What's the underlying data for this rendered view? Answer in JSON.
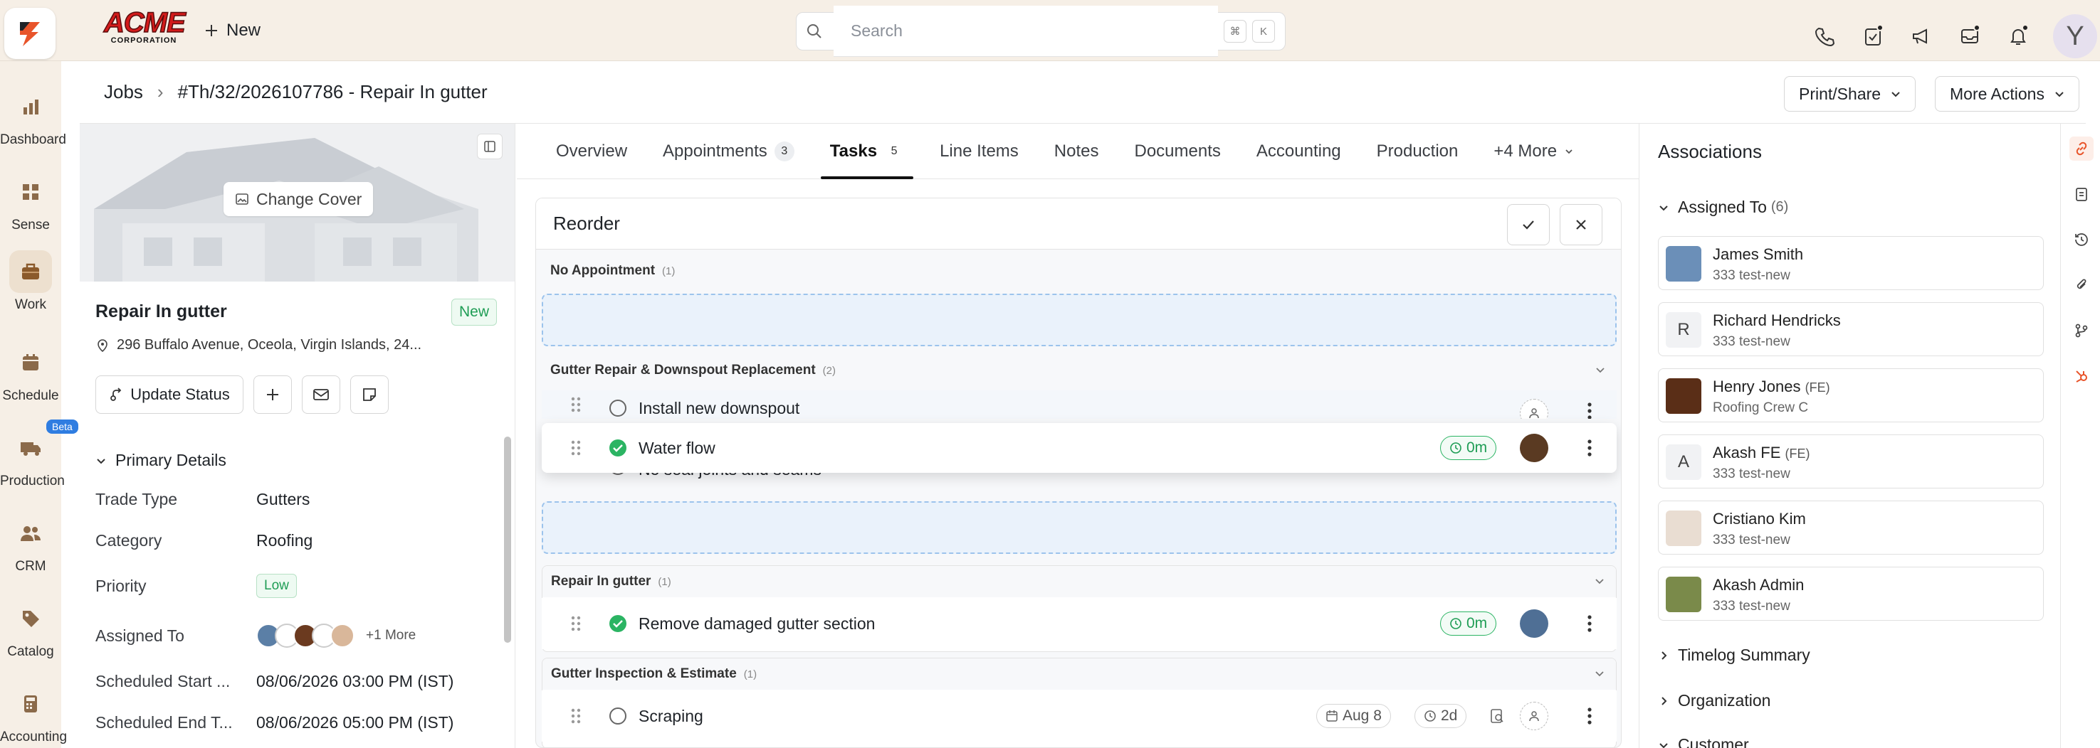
{
  "app": {
    "brand": "ACME",
    "brand_sub": "CORPORATION",
    "new_label": "New",
    "search_placeholder": "Search",
    "shortcut_cmd": "⌘",
    "shortcut_key": "K",
    "user_initial": "Y"
  },
  "nav": [
    {
      "label": "Dashboard",
      "icon": "bar-chart-icon"
    },
    {
      "label": "Sense",
      "icon": "grid-icon"
    },
    {
      "label": "Work",
      "icon": "briefcase-icon",
      "active": true
    },
    {
      "label": "Schedule",
      "icon": "calendar-icon"
    },
    {
      "label": "Production",
      "icon": "truck-icon",
      "badge": "Beta"
    },
    {
      "label": "CRM",
      "icon": "users-icon"
    },
    {
      "label": "Catalog",
      "icon": "tag-icon"
    },
    {
      "label": "Accounting",
      "icon": "calculator-icon"
    }
  ],
  "breadcrumb": {
    "root": "Jobs",
    "current": "#Th/32/2026107786 - Repair In gutter"
  },
  "header_actions": {
    "print_share": "Print/Share",
    "more_actions": "More Actions"
  },
  "job": {
    "change_cover": "Change Cover",
    "title": "Repair In gutter",
    "status_badge": "New",
    "address": "296 Buffalo Avenue, Oceola, Virgin Islands, 24...",
    "update_status": "Update Status"
  },
  "primary_details": {
    "heading": "Primary Details",
    "trade_type_label": "Trade Type",
    "trade_type": "Gutters",
    "category_label": "Category",
    "category": "Roofing",
    "priority_label": "Priority",
    "priority": "Low",
    "assigned_label": "Assigned To",
    "assigned_more": "+1 More",
    "start_label": "Scheduled Start ...",
    "start": "08/06/2026 03:00 PM (IST)",
    "end_label": "Scheduled End T...",
    "end": "08/06/2026 05:00 PM (IST)"
  },
  "tabs": [
    {
      "label": "Overview"
    },
    {
      "label": "Appointments",
      "count": "3"
    },
    {
      "label": "Tasks",
      "count": "5",
      "active": true
    },
    {
      "label": "Line Items"
    },
    {
      "label": "Notes"
    },
    {
      "label": "Documents"
    },
    {
      "label": "Accounting"
    },
    {
      "label": "Production"
    },
    {
      "label": "+4 More"
    }
  ],
  "reorder": {
    "title": "Reorder",
    "groups": [
      {
        "name": "No Appointment",
        "count": "(1)"
      },
      {
        "name": "Gutter Repair & Downspout Replacement",
        "count": "(2)"
      },
      {
        "name": "Repair In gutter",
        "count": "(1)"
      },
      {
        "name": "Gutter Inspection & Estimate",
        "count": "(1)"
      }
    ],
    "tasks": {
      "install": "Install new downspout",
      "dragging": "Water flow",
      "dragging_time": "0m",
      "hidden": "No seal joints and seams",
      "remove": "Remove damaged gutter section",
      "remove_time": "0m",
      "scraping": "Scraping",
      "scraping_date": "Aug 8",
      "scraping_duration": "2d"
    }
  },
  "associations": {
    "title": "Associations",
    "assigned_heading": "Assigned To",
    "assigned_count": "(6)",
    "people": [
      {
        "name": "James Smith",
        "tag": "",
        "sub": "333 test-new",
        "initial": ""
      },
      {
        "name": "Richard Hendricks",
        "tag": "",
        "sub": "333 test-new",
        "initial": "R"
      },
      {
        "name": "Henry Jones",
        "tag": "(FE)",
        "sub": "Roofing Crew C",
        "initial": ""
      },
      {
        "name": "Akash FE",
        "tag": "(FE)",
        "sub": "333 test-new",
        "initial": "A"
      },
      {
        "name": "Cristiano Kim",
        "tag": "",
        "sub": "333 test-new",
        "initial": ""
      },
      {
        "name": "Akash Admin",
        "tag": "",
        "sub": "333 test-new",
        "initial": ""
      }
    ],
    "timelog": "Timelog Summary",
    "organization": "Organization",
    "customer": "Customer"
  },
  "colors": {
    "accent": "#e8542a",
    "success": "#1f9d55",
    "drop_zone": "#9cc3ec"
  }
}
